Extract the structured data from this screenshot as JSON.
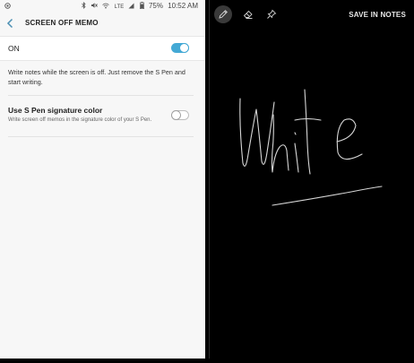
{
  "status_bar": {
    "battery": "75%",
    "time": "10:52 AM",
    "network": "LTE",
    "icons": [
      "circle-icon",
      "bluetooth-icon",
      "mute-icon",
      "wifi-icon",
      "signal-icon",
      "battery-icon"
    ]
  },
  "settings": {
    "title": "SCREEN OFF MEMO",
    "master_switch": {
      "label": "ON",
      "state": true
    },
    "description": "Write notes while the screen is off. Just remove the S Pen and start writing.",
    "signature_color": {
      "title": "Use S Pen signature color",
      "subtitle": "Write screen off memos in the signature color of your S Pen.",
      "state": false
    }
  },
  "memo": {
    "tools": [
      "pen-icon",
      "eraser-icon",
      "pin-icon"
    ],
    "active_tool": "pen-icon",
    "save_label": "SAVE IN NOTES",
    "handwriting": "White"
  },
  "colors": {
    "accent": "#44a9d5",
    "settings_bg": "#f7f7f7",
    "canvas_bg": "#000000",
    "ink": "#d8d8d8"
  }
}
